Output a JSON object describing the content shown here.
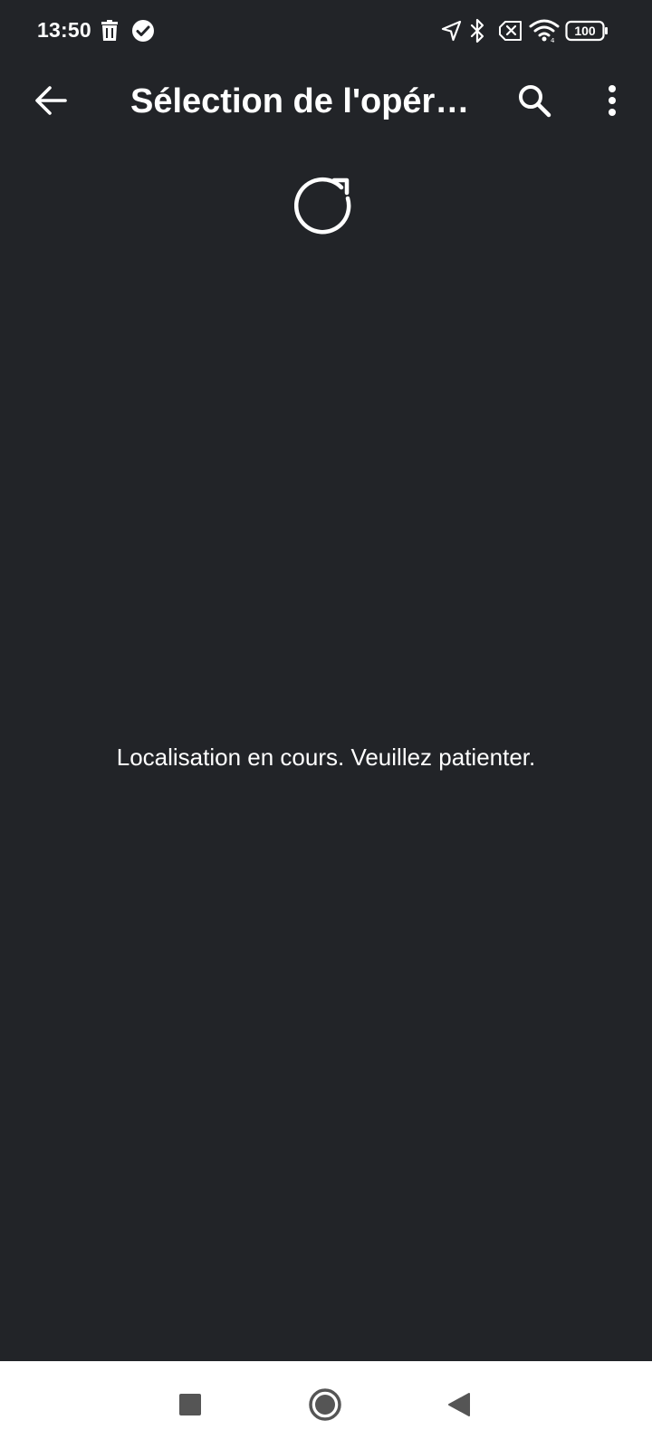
{
  "status_bar": {
    "time": "13:50",
    "battery_level": "100",
    "icons": [
      "trash-icon",
      "check-circle-icon",
      "location-arrow-icon",
      "bluetooth-icon",
      "no-sim-icon",
      "wifi-icon",
      "battery-icon"
    ]
  },
  "app_bar": {
    "title": "Sélection de l'opéra…",
    "back_icon": "arrow-back-icon",
    "search_icon": "search-icon",
    "more_icon": "more-vert-icon"
  },
  "main": {
    "refresh_icon": "refresh-icon",
    "message": "Localisation en cours. Veuillez patienter."
  },
  "nav_bar": {
    "icons": [
      "recents-square-icon",
      "home-circle-icon",
      "back-triangle-icon"
    ]
  },
  "colors": {
    "background": "#222428",
    "foreground": "#ffffff",
    "nav_background": "#ffffff",
    "nav_icons": "#555555"
  }
}
